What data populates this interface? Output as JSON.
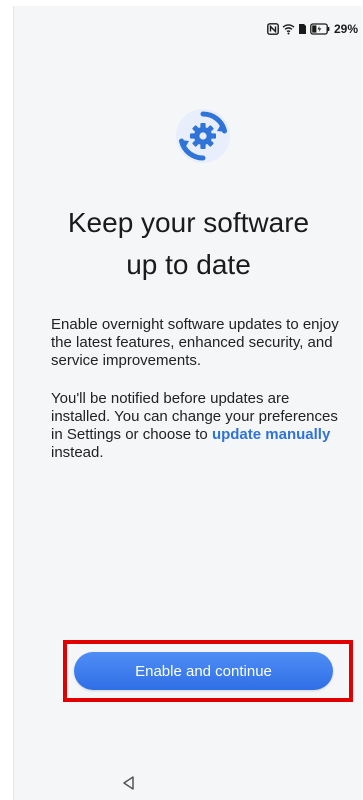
{
  "status_bar": {
    "icons": [
      "nfc-icon",
      "wifi-icon",
      "sim-icon",
      "battery-charging-icon"
    ],
    "battery_percent": "29%"
  },
  "hero": {
    "icon": "settings-gear-sync-icon",
    "accent_color": "#2f74d6"
  },
  "title": {
    "line1": "Keep your software",
    "line2": "up to date"
  },
  "body": {
    "paragraph1": "Enable overnight software updates to enjoy the latest features, enhanced security, and service improvements.",
    "paragraph2_before": "You'll be notified before updates are installed. You can change your preferences in Settings or choose to ",
    "paragraph2_link": "update manually",
    "paragraph2_after": " instead."
  },
  "actions": {
    "primary_label": "Enable and continue",
    "primary_color": "#3a7ef0",
    "highlight_color": "#e10000"
  },
  "navigation": {
    "back_icon": "back-triangle-icon"
  }
}
